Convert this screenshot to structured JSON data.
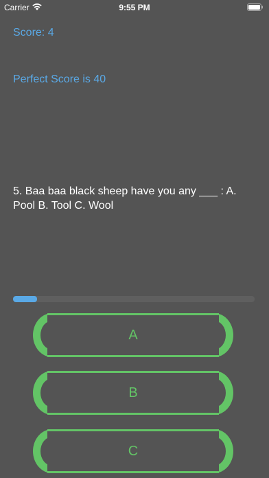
{
  "status_bar": {
    "carrier": "Carrier",
    "time": "9:55 PM"
  },
  "quiz": {
    "score_label": "Score: 4",
    "perfect_score_label": "Perfect Score is 40",
    "question": "5. Baa baa black sheep have you any ___ : A. Pool  B. Tool  C. Wool",
    "progress_fraction": 0.1
  },
  "answers": [
    {
      "label": "A"
    },
    {
      "label": "B"
    },
    {
      "label": "C"
    }
  ],
  "colors": {
    "background": "#545454",
    "accent_blue": "#5aa9e6",
    "button_green": "#63c466",
    "text_white": "#ffffff"
  },
  "icons": [
    "wifi-icon",
    "battery-icon"
  ]
}
